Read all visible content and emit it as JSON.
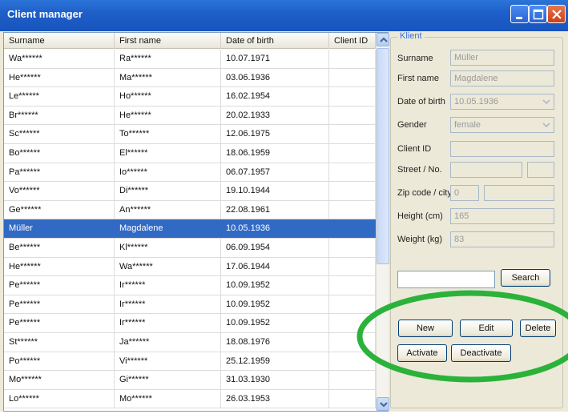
{
  "window": {
    "title": "Client manager"
  },
  "table": {
    "columns": [
      "Surname",
      "First name",
      "Date of birth",
      "Client ID"
    ],
    "rows": [
      [
        "Wa******",
        "Ra******",
        "10.07.1971",
        ""
      ],
      [
        "He******",
        "Ma******",
        "03.06.1936",
        ""
      ],
      [
        "Le******",
        "Ho******",
        "16.02.1954",
        ""
      ],
      [
        "Br******",
        "He******",
        "20.02.1933",
        ""
      ],
      [
        "Sc******",
        "To******",
        "12.06.1975",
        ""
      ],
      [
        "Bo******",
        "El******",
        "18.06.1959",
        ""
      ],
      [
        "Pa******",
        "Io******",
        "06.07.1957",
        ""
      ],
      [
        "Vo******",
        "Di******",
        "19.10.1944",
        ""
      ],
      [
        "Ge******",
        "An******",
        "22.08.1961",
        ""
      ],
      [
        "Müller",
        "Magdalene",
        "10.05.1936",
        ""
      ],
      [
        "Be******",
        "Kl******",
        "06.09.1954",
        ""
      ],
      [
        "He******",
        "Wa******",
        "17.06.1944",
        ""
      ],
      [
        "Pe******",
        "Ir******",
        "10.09.1952",
        ""
      ],
      [
        "Pe******",
        "Ir******",
        "10.09.1952",
        ""
      ],
      [
        "Pe******",
        "Ir******",
        "10.09.1952",
        ""
      ],
      [
        "St******",
        "Ja******",
        "18.08.1976",
        ""
      ],
      [
        "Po******",
        "Vi******",
        "25.12.1959",
        ""
      ],
      [
        "Mo******",
        "Gi******",
        "31.03.1930",
        ""
      ],
      [
        "Lo******",
        "Mo******",
        "26.03.1953",
        ""
      ]
    ],
    "selected_index": 9
  },
  "form": {
    "group_label": "Klient",
    "surname_label": "Surname",
    "surname_value": "Müller",
    "firstname_label": "First name",
    "firstname_value": "Magdalene",
    "dob_label": "Date of birth",
    "dob_value": "10.05.1936",
    "gender_label": "Gender",
    "gender_value": "female",
    "clientid_label": "Client ID",
    "clientid_value": "",
    "street_label": "Street / No.",
    "street_value": "",
    "street_no_value": "",
    "zip_label": "Zip code / city",
    "zip_value": "0",
    "city_value": "",
    "height_label": "Height (cm)",
    "height_value": "165",
    "weight_label": "Weight (kg)",
    "weight_value": "83",
    "search_value": "",
    "search_button": "Search",
    "new_button": "New",
    "edit_button": "Edit",
    "delete_button": "Delete",
    "activate_button": "Activate",
    "deactivate_button": "Deactivate"
  },
  "colors": {
    "titlebar": "#1e5fc9",
    "selection": "#316ac5",
    "highlight_ellipse": "#2bb23a"
  },
  "icons": [
    "minimize-icon",
    "maximize-icon",
    "close-icon",
    "scroll-up-icon",
    "scroll-down-icon",
    "dropdown-arrow-icon"
  ]
}
